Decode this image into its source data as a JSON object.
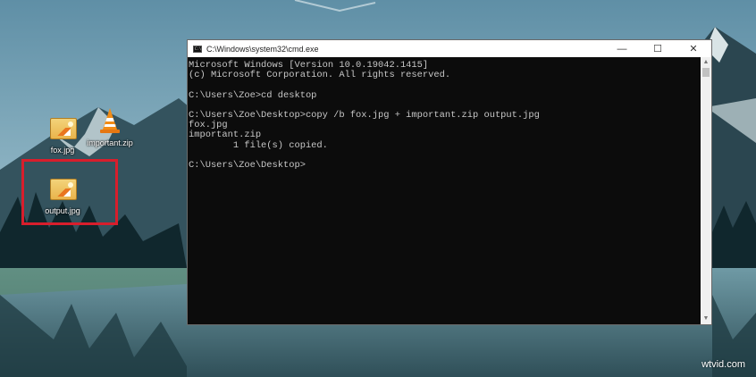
{
  "desktop": {
    "icons": [
      {
        "label": "fox.jpg",
        "icon": "image-file-icon"
      },
      {
        "label": "important.zip",
        "icon": "vlc-cone-icon"
      },
      {
        "label": "output.jpg",
        "icon": "image-file-icon"
      }
    ],
    "highlight_color": "#d81e2c"
  },
  "cmd": {
    "title": "C:\\Windows\\system32\\cmd.exe",
    "minimize": "—",
    "maximize": "☐",
    "close": "✕",
    "lines": [
      "Microsoft Windows [Version 10.0.19042.1415]",
      "(c) Microsoft Corporation. All rights reserved.",
      "",
      "C:\\Users\\Zoe>cd desktop",
      "",
      "C:\\Users\\Zoe\\Desktop>copy /b fox.jpg + important.zip output.jpg",
      "fox.jpg",
      "important.zip",
      "        1 file(s) copied.",
      "",
      "C:\\Users\\Zoe\\Desktop>"
    ]
  },
  "watermark": "wtvid.com"
}
